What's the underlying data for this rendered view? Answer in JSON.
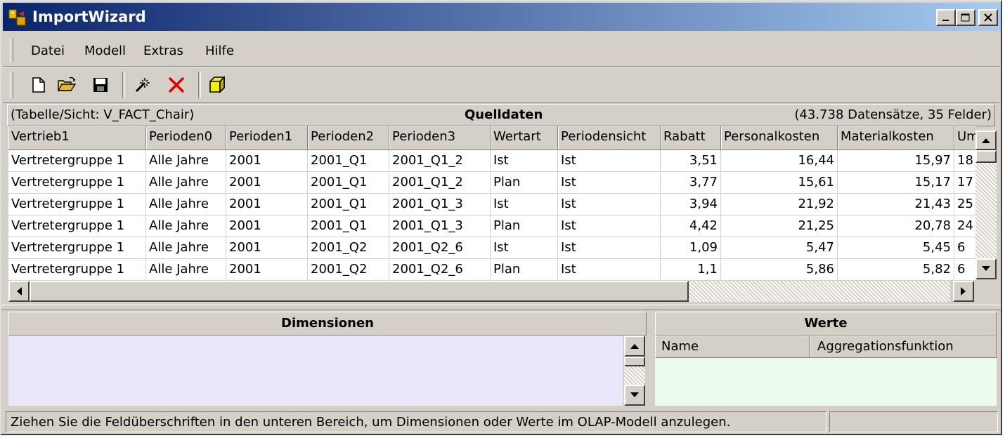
{
  "window": {
    "title": "ImportWizard",
    "controls": [
      "minimize",
      "maximize",
      "close"
    ]
  },
  "menu": {
    "items": [
      "Datei",
      "Modell",
      "Extras",
      "Hilfe"
    ]
  },
  "toolbar": {
    "icons": [
      "new-file-icon",
      "open-folder-icon",
      "save-icon",
      "magic-wand-icon",
      "delete-icon",
      "cube-icon"
    ]
  },
  "source": {
    "table_info": "(Tabelle/Sicht: V_FACT_Chair)",
    "title": "Quelldaten",
    "record_info": "(43.738 Datensätze, 35 Felder)",
    "columns": [
      "Vertrieb1",
      "Perioden0",
      "Perioden1",
      "Perioden2",
      "Perioden3",
      "Wertart",
      "Periodensicht",
      "Rabatt",
      "Personalkosten",
      "Materialkosten",
      "Um"
    ],
    "rows": [
      [
        "Vertretergruppe 1",
        "Alle Jahre",
        "2001",
        "2001_Q1",
        "2001_Q1_2",
        "Ist",
        "Ist",
        "3,51",
        "16,44",
        "15,97",
        "18"
      ],
      [
        "Vertretergruppe 1",
        "Alle Jahre",
        "2001",
        "2001_Q1",
        "2001_Q1_2",
        "Plan",
        "Ist",
        "3,77",
        "15,61",
        "15,17",
        "17"
      ],
      [
        "Vertretergruppe 1",
        "Alle Jahre",
        "2001",
        "2001_Q1",
        "2001_Q1_3",
        "Ist",
        "Ist",
        "3,94",
        "21,92",
        "21,43",
        "25"
      ],
      [
        "Vertretergruppe 1",
        "Alle Jahre",
        "2001",
        "2001_Q1",
        "2001_Q1_3",
        "Plan",
        "Ist",
        "4,42",
        "21,25",
        "20,78",
        "24"
      ],
      [
        "Vertretergruppe 1",
        "Alle Jahre",
        "2001",
        "2001_Q2",
        "2001_Q2_6",
        "Ist",
        "Ist",
        "1,09",
        "5,47",
        "5,45",
        "6"
      ],
      [
        "Vertretergruppe 1",
        "Alle Jahre",
        "2001",
        "2001_Q2",
        "2001_Q2_6",
        "Plan",
        "Ist",
        "1,1",
        "5,86",
        "5,82",
        "6"
      ]
    ]
  },
  "dimensions": {
    "title": "Dimensionen",
    "bg_color": "#e8e8fa"
  },
  "values": {
    "title": "Werte",
    "col_name": "Name",
    "col_aggregation": "Aggregationsfunktion",
    "bg_color": "#ecfcec"
  },
  "status": {
    "text": "Ziehen Sie die Feldüberschriften in den unteren Bereich, um Dimensionen oder Werte im OLAP-Modell anzulegen."
  }
}
